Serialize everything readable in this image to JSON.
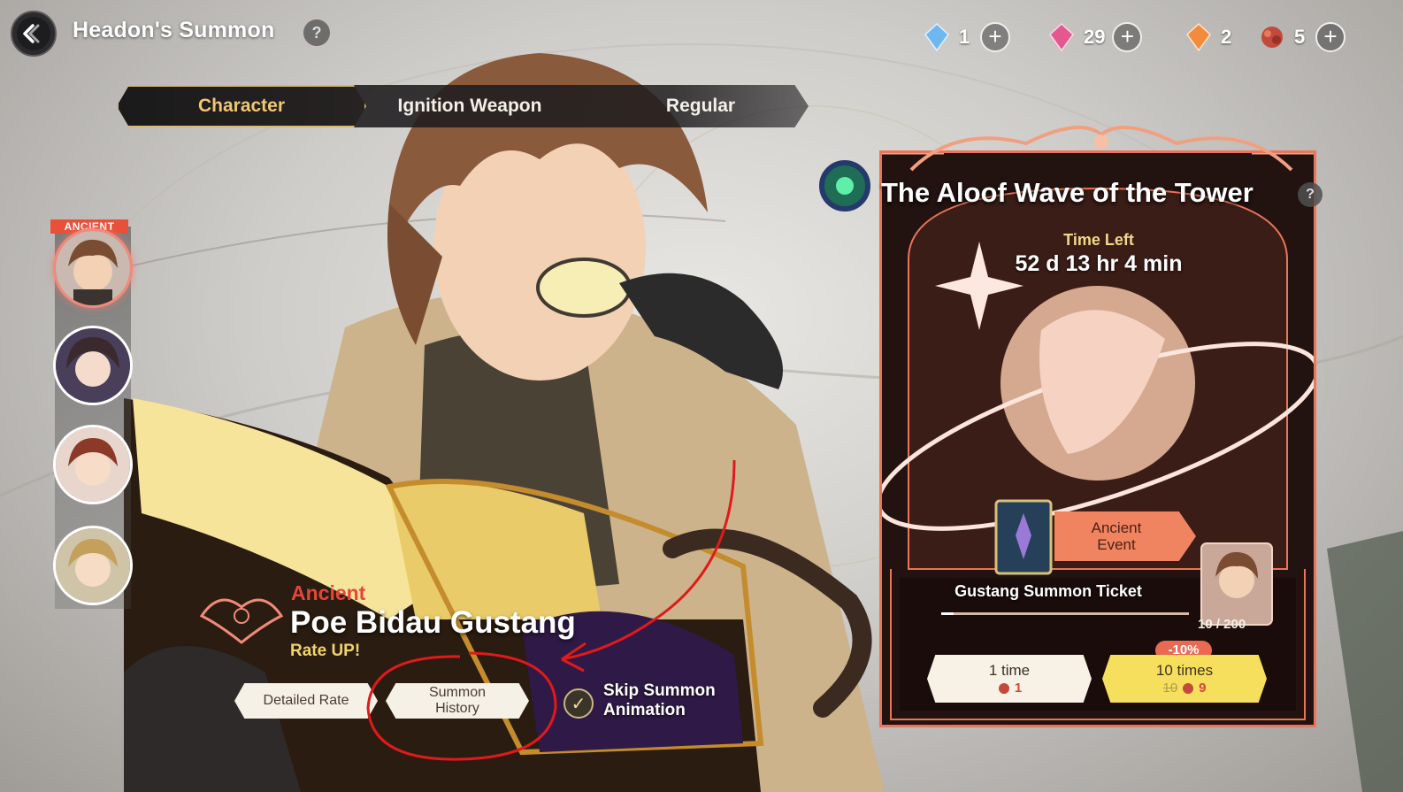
{
  "header": {
    "title": "Headon's Summon",
    "help": "?",
    "back_icon": "back-arrow-icon",
    "currencies": [
      {
        "name": "blue-crystal-icon",
        "amount": "1",
        "color": "#5aa6e8"
      },
      {
        "name": "pink-crystal-icon",
        "amount": "29",
        "color": "#e2558c"
      },
      {
        "name": "orange-crystal-icon",
        "amount": "2",
        "color": "#f2843a"
      },
      {
        "name": "summon-ticket-icon",
        "amount": "5",
        "color": "#c2493c"
      }
    ],
    "plus": "+"
  },
  "tabs": {
    "character": "Character",
    "ignition_weapon": "Ignition Weapon",
    "regular": "Regular"
  },
  "rail": {
    "ancient_tag": "ANCIENT"
  },
  "character": {
    "rarity": "Ancient",
    "name": "Poe Bidau Gustang",
    "rate_up": "Rate UP!",
    "detailed_rate": "Detailed Rate",
    "summon_history_line1": "Summon",
    "summon_history_line2": "History",
    "skip_line1": "Skip Summon",
    "skip_line2": "Animation",
    "check": "✓"
  },
  "banner": {
    "title": "The Aloof Wave of the Tower",
    "help": "?",
    "time_label": "Time Left",
    "time_value": "52 d 13 hr 4 min",
    "event_line1": "Ancient",
    "event_line2": "Event",
    "ticket_label": "Gustang Summon Ticket",
    "pity": "10 / 200",
    "pity_progress": 0.05,
    "discount": "-10%",
    "summon_one": {
      "label": "1 time",
      "cost": "1"
    },
    "summon_ten": {
      "label": "10 times",
      "old_cost": "10",
      "cost": "9"
    },
    "accent_color": "#e9755a"
  }
}
